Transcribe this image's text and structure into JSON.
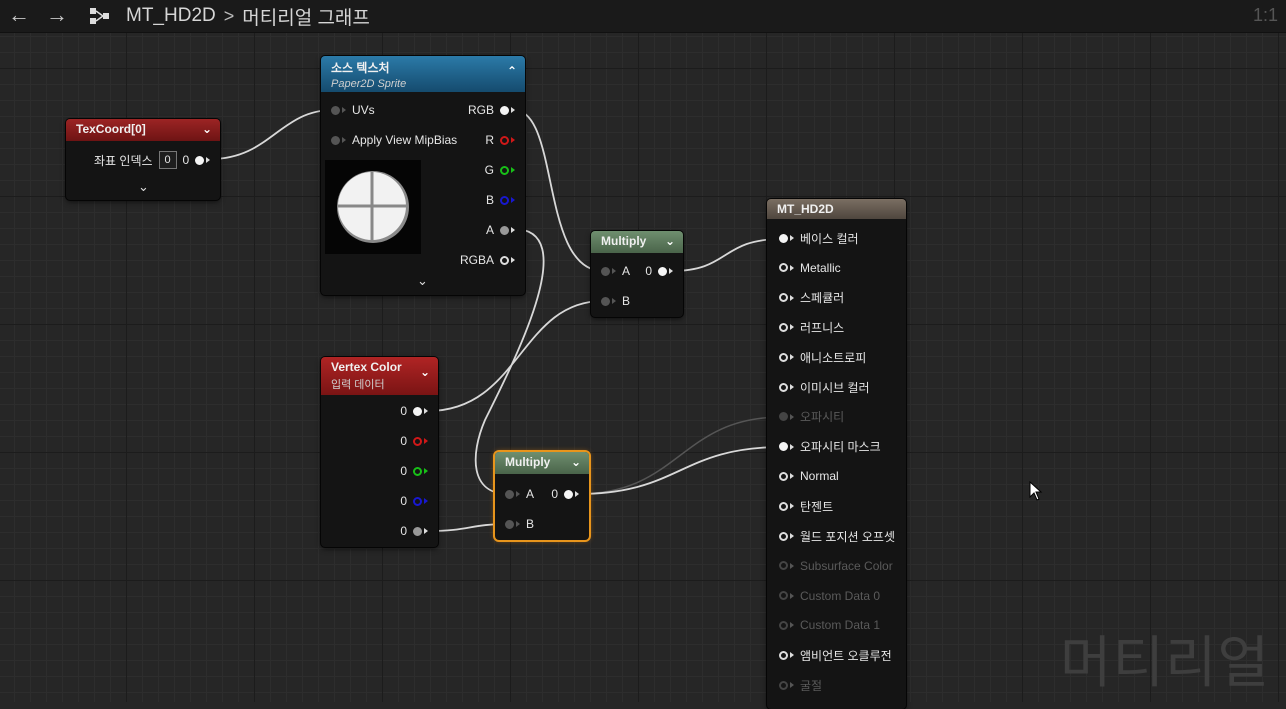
{
  "topbar": {
    "back_icon": "arrow-left-icon",
    "forward_icon": "arrow-right-icon",
    "graph_icon": "material-graph-icon",
    "asset_name": "MT_HD2D",
    "separator": ">",
    "graph_name": "머티리얼 그래프",
    "zoom": "1:1"
  },
  "nodes": {
    "texcoord": {
      "title": "TexCoord[0]",
      "pin_label": "좌표 인덱스",
      "index_value": "0",
      "output_label": "0"
    },
    "source_texture": {
      "title": "소스 텍스처",
      "subtitle": "Paper2D Sprite",
      "inputs": [
        "UVs",
        "Apply View MipBias"
      ],
      "outputs": [
        "RGB",
        "R",
        "G",
        "B",
        "A",
        "RGBA"
      ]
    },
    "multiply1": {
      "title": "Multiply",
      "input_a": "A",
      "input_b": "B",
      "output": "0"
    },
    "vertex_color": {
      "title": "Vertex Color",
      "subtitle": "입력 데이터",
      "outputs": [
        "0",
        "0",
        "0",
        "0",
        "0"
      ]
    },
    "multiply2": {
      "title": "Multiply",
      "input_a": "A",
      "input_b": "B",
      "output": "0"
    },
    "material": {
      "title": "MT_HD2D",
      "inputs": [
        {
          "label": "베이스 컬러",
          "active": true,
          "connected": true
        },
        {
          "label": "Metallic",
          "active": true,
          "connected": false
        },
        {
          "label": "스페큘러",
          "active": true,
          "connected": false
        },
        {
          "label": "러프니스",
          "active": true,
          "connected": false
        },
        {
          "label": "애니소트로피",
          "active": true,
          "connected": false
        },
        {
          "label": "이미시브 컬러",
          "active": true,
          "connected": false
        },
        {
          "label": "오파시티",
          "active": false,
          "connected": true
        },
        {
          "label": "오파시티 마스크",
          "active": true,
          "connected": true
        },
        {
          "label": "Normal",
          "active": true,
          "connected": false
        },
        {
          "label": "탄젠트",
          "active": true,
          "connected": false
        },
        {
          "label": "월드 포지션 오프셋",
          "active": true,
          "connected": false
        },
        {
          "label": "Subsurface Color",
          "active": false,
          "connected": false
        },
        {
          "label": "Custom Data 0",
          "active": false,
          "connected": false
        },
        {
          "label": "Custom Data 1",
          "active": false,
          "connected": false
        },
        {
          "label": "앰비언트 오클루전",
          "active": true,
          "connected": false
        },
        {
          "label": "굴절",
          "active": false,
          "connected": false
        }
      ]
    }
  },
  "watermark": "머티리얼",
  "colors": {
    "texcoord_header": "#8a1c1c",
    "texture_header": "#1f5f8a",
    "multiply_header": "#5a7a5a",
    "vertex_header": "#9a1c1c",
    "material_header": "#6a5f55",
    "selection": "#e8951c",
    "annotation": "#e00000"
  }
}
